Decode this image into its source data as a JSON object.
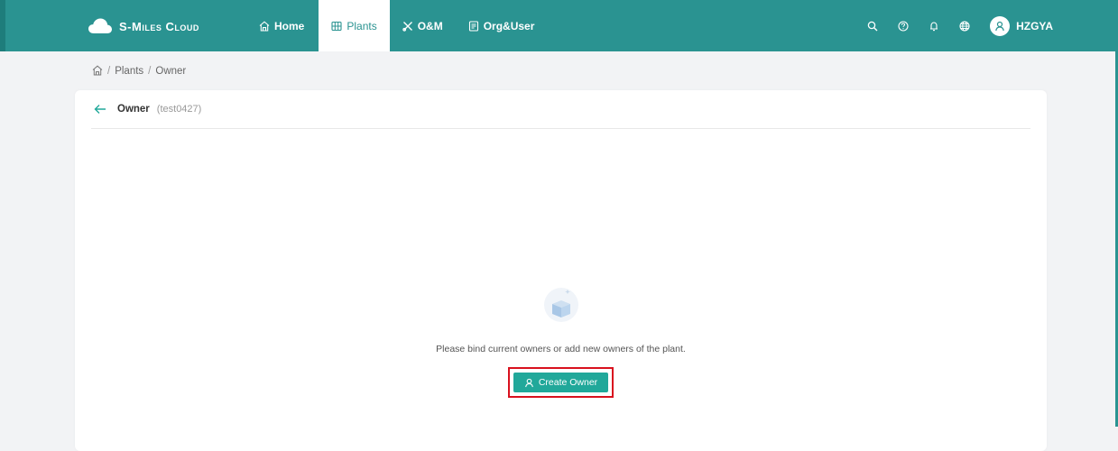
{
  "brand": {
    "name": "S-Miles Cloud"
  },
  "nav": {
    "items": [
      {
        "label": "Home",
        "icon": "home-icon"
      },
      {
        "label": "Plants",
        "icon": "grid-icon",
        "active": true
      },
      {
        "label": "O&M",
        "icon": "tools-icon"
      },
      {
        "label": "Org&User",
        "icon": "document-icon"
      }
    ]
  },
  "toolbar": {
    "icons": [
      "search-icon",
      "help-icon",
      "bell-icon",
      "globe-icon"
    ],
    "username": "HZGYA"
  },
  "breadcrumb": {
    "items": [
      "Plants",
      "Owner"
    ]
  },
  "card": {
    "title": "Owner",
    "subtitle": "(test0427)"
  },
  "empty_state": {
    "message": "Please bind current owners or add new owners of the plant.",
    "button_label": "Create Owner"
  },
  "colors": {
    "topbar": "#2a9391",
    "accent": "#21a89a",
    "highlight": "#d9111e"
  }
}
